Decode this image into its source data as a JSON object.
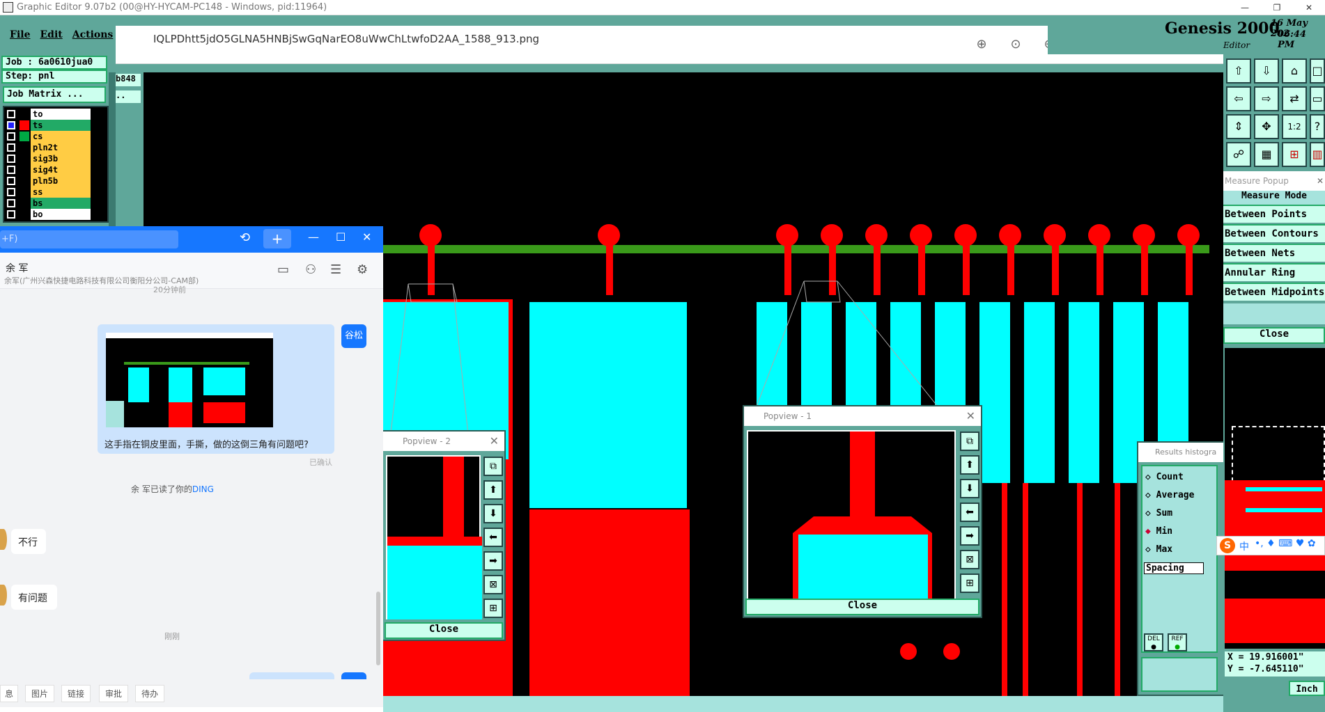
{
  "app": {
    "title": "Graphic Editor 9.07b2 (00@HY-HYCAM-PC148 - Windows, pid:11964)",
    "minimize": "—",
    "restore": "❐",
    "close": "✕"
  },
  "menu": {
    "file": "File",
    "edit": "Edit",
    "actions": "Actions"
  },
  "job": {
    "job_label": "Job  : 6a0610jua0",
    "step_label": "Step: pnl",
    "matrix_button": "Job Matrix ..."
  },
  "layers": [
    {
      "name": "to",
      "color": "#ffffff",
      "swatch": "#000000"
    },
    {
      "name": "ts",
      "color": "#22aa66",
      "swatch": "#ff0000"
    },
    {
      "name": "cs",
      "color": "#ffcc44",
      "swatch": "#00aa44"
    },
    {
      "name": "pln2t",
      "color": "#ffcc44",
      "swatch": "#000000"
    },
    {
      "name": "sig3b",
      "color": "#ffcc44",
      "swatch": "#000000"
    },
    {
      "name": "sig4t",
      "color": "#ffcc44",
      "swatch": "#000000"
    },
    {
      "name": "pln5b",
      "color": "#ffcc44",
      "swatch": "#000000"
    },
    {
      "name": "ss",
      "color": "#ffcc44",
      "swatch": "#000000"
    },
    {
      "name": "bs",
      "color": "#22aa66",
      "swatch": "#000000"
    },
    {
      "name": "bo",
      "color": "#ffffff",
      "swatch": "#000000"
    }
  ],
  "aux": {
    "b848": "b848",
    "dots": ".."
  },
  "viewer": {
    "filename": "IQLPDhtt5jdO5GLNA5HNBjSwGqNarEO8uWwChLtwfoD2AA_1588_913.png"
  },
  "header_right": {
    "brand": "Genesis 2000",
    "date": "16 May 202",
    "time": "06:44 PM",
    "editor": "Editor"
  },
  "measure": {
    "title": "Measure Popup",
    "mode_header": "Measure Mode",
    "items": [
      "Between Points",
      "Between Contours",
      "Between Nets",
      "Annular Ring",
      "Between Midpoints"
    ],
    "close": "Close"
  },
  "popview2": {
    "title": "Popview - 2",
    "close": "Close"
  },
  "popview1": {
    "title": "Popview - 1",
    "close": "Close"
  },
  "histogram": {
    "title": "Results histogra",
    "options": [
      "Count",
      "Average",
      "Sum",
      "Min",
      "Max"
    ],
    "selected": "Min",
    "field": "Spacing",
    "del": "DEL",
    "ref": "REF"
  },
  "coords": {
    "x": "X = 19.916001\"",
    "y": "Y = -7.645110\"",
    "unit": "Inch"
  },
  "chat": {
    "search_placeholder": "+F)",
    "contact_name": "余 军",
    "contact_org": "余军(广州兴森快捷电路科技有限公司衡阳分公司-CAM部)",
    "time_cut": "20分钟前",
    "my_avatar": "谷松",
    "image_caption": "这手指在铜皮里面，手撕，做的这倒三角有问题吧?",
    "confirmed": "已确认",
    "read_notice_prefix": "余 军已读了你的",
    "read_notice_link": "DING",
    "reply1": "不行",
    "reply2": "有问题",
    "just_now": "刚刚",
    "bottom_tabs": [
      "息",
      "图片",
      "链接",
      "审批",
      "待办"
    ]
  },
  "ime": {
    "label": "中"
  }
}
